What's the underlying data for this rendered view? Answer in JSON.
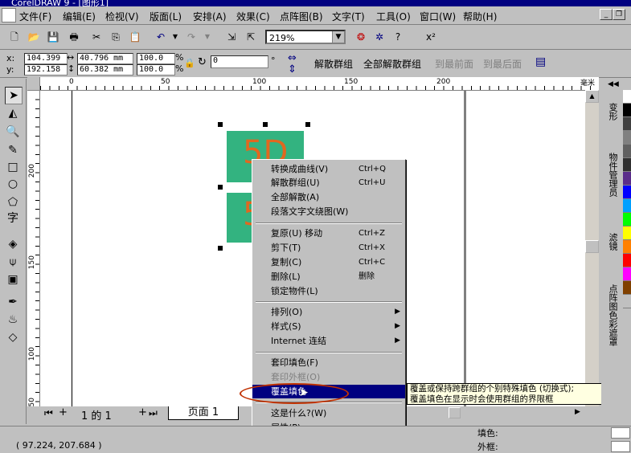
{
  "window": {
    "title": "CorelDRAW 9 - [图形1]"
  },
  "menu": [
    "文件(F)",
    "编辑(E)",
    "检视(V)",
    "版面(L)",
    "安排(A)",
    "效果(C)",
    "点阵图(B)",
    "文字(T)",
    "工具(O)",
    "窗口(W)",
    "帮助(H)"
  ],
  "toolbar": {
    "zoom_value": "219%"
  },
  "property_bar": {
    "x_label": "x:",
    "y_label": "y:",
    "x_value": "104.399",
    "y_value": "192.158",
    "width_value": "40.796 mm",
    "height_value": "60.382 mm",
    "scale_w": "100.0",
    "scale_h": "100.0",
    "percent": "%",
    "angle_value": "0",
    "degree": "°",
    "buttons": [
      "解散群组",
      "全部解散群组",
      "到最前面",
      "到最后面"
    ]
  },
  "ruler": {
    "h_ticks": [
      "0",
      "50",
      "100",
      "150",
      "200"
    ],
    "h_unit": "毫米",
    "v_ticks": [
      "200",
      "150",
      "100",
      "50"
    ]
  },
  "canvas": {
    "object_text_top": "5D",
    "object_text_bottom": "5"
  },
  "context_menu": {
    "items": [
      {
        "label": "转换成曲线(V)",
        "shortcut": "Ctrl+Q"
      },
      {
        "label": "解散群组(U)",
        "shortcut": "Ctrl+U"
      },
      {
        "label": "全部解散(A)",
        "shortcut": ""
      },
      {
        "label": "段落文字文绕图(W)",
        "shortcut": ""
      },
      {
        "label": "复原(U) 移动",
        "shortcut": "Ctrl+Z"
      },
      {
        "label": "剪下(T)",
        "shortcut": "Ctrl+X"
      },
      {
        "label": "复制(C)",
        "shortcut": "Ctrl+C"
      },
      {
        "label": "删除(L)",
        "shortcut": "删除"
      },
      {
        "label": "锁定物件(L)",
        "shortcut": ""
      },
      {
        "label": "排列(O)",
        "shortcut": ""
      },
      {
        "label": "样式(S)",
        "shortcut": ""
      },
      {
        "label": "Internet 连结",
        "shortcut": ""
      },
      {
        "label": "套印填色(F)",
        "shortcut": ""
      },
      {
        "label": "套印外框(O)",
        "shortcut": ""
      },
      {
        "label": "覆盖填色",
        "shortcut": ""
      },
      {
        "label": "这是什么?(W)",
        "shortcut": ""
      },
      {
        "label": "属性(P)...",
        "shortcut": ""
      }
    ]
  },
  "tooltip": {
    "line1": "覆盖或保持跨群组的个别特殊填色 (切换式);",
    "line2": "覆盖填色在显示时会使用群组的界限框"
  },
  "page_nav": {
    "position": "1 的 1",
    "tab": "页面 1"
  },
  "status": {
    "coords": "( 97.224, 207.684 )",
    "fill_label": "填色:",
    "outline_label": "外框:"
  },
  "docker_tabs": [
    "变形",
    "物件管理员",
    "滤镜",
    "点阵图色彩遮罩"
  ],
  "palette_colors": [
    "#ffffff",
    "#000000",
    "#404040",
    "#808080",
    "#606060",
    "#303030",
    "#5a2d8a",
    "#0000ff",
    "#00a0ff",
    "#00ff00",
    "#ffff00",
    "#ff8000",
    "#ff0000",
    "#ff00ff",
    "#804000",
    "#c0c0c0"
  ]
}
